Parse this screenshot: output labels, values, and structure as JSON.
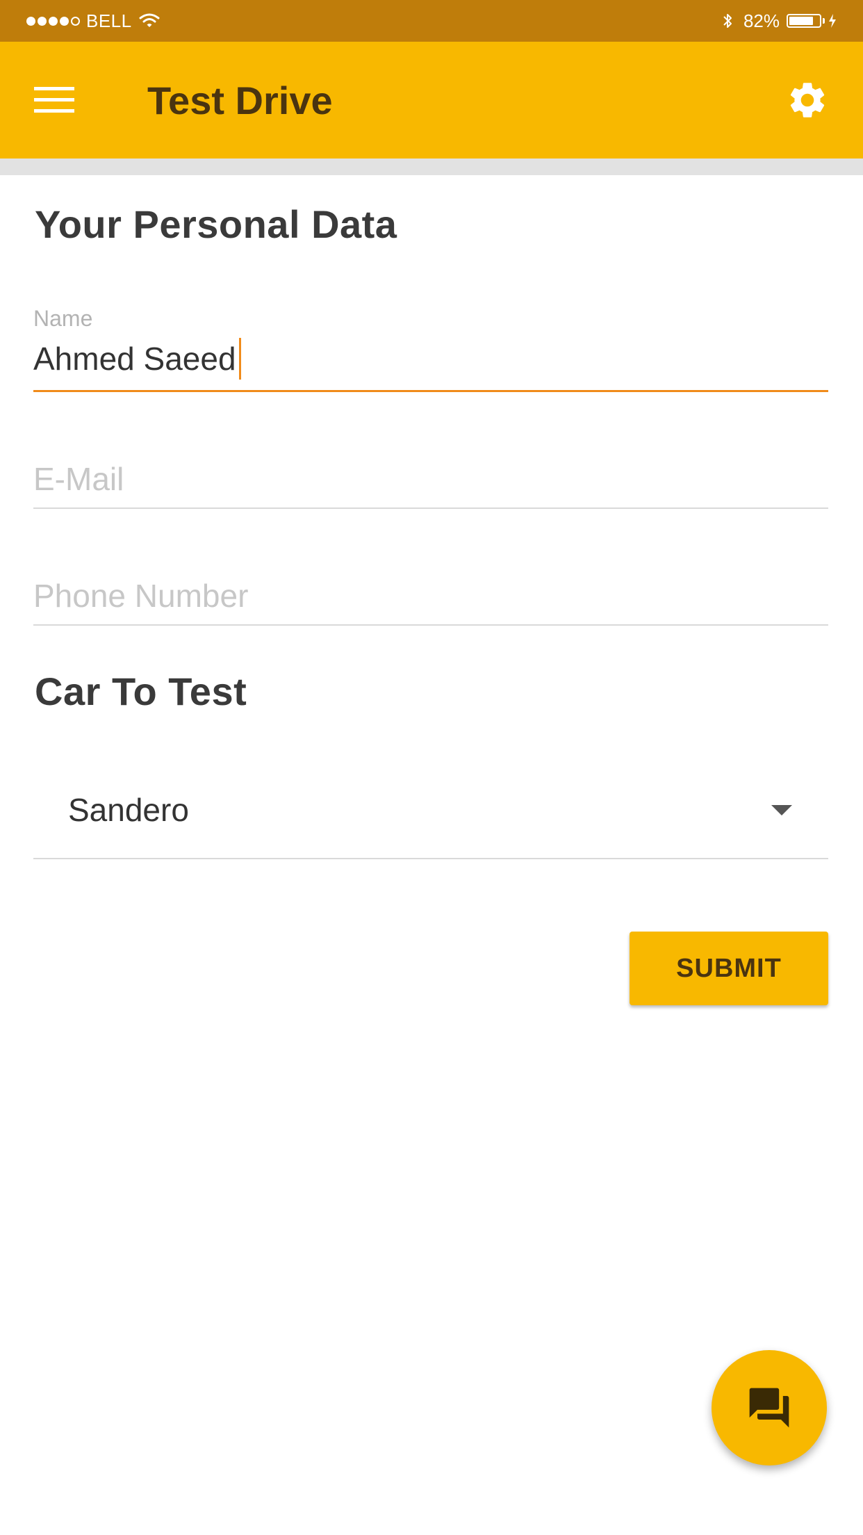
{
  "status_bar": {
    "carrier": "BELL",
    "battery": "82%",
    "battery_level": 0.82,
    "signal_bars": 4,
    "signal_max": 5
  },
  "app_bar": {
    "title": "Test Drive",
    "menu_icon": "menu-icon",
    "settings_icon": "gear-icon",
    "background": "#F8B800"
  },
  "personal_section": {
    "title": "Your Personal Data",
    "name_field": {
      "label": "Name",
      "value": "Ahmed Saeed"
    },
    "email_field": {
      "placeholder": "E-Mail",
      "value": ""
    },
    "phone_field": {
      "placeholder": "Phone Number",
      "value": ""
    }
  },
  "car_section": {
    "title": "Car To Test",
    "selected": "Sandero"
  },
  "actions": {
    "submit_label": "SUBMIT",
    "fab_icon": "chat-icon"
  },
  "colors": {
    "accent": "#F8B800",
    "status_bar": "#BF7D0B",
    "focus_line": "#F08B1B"
  }
}
